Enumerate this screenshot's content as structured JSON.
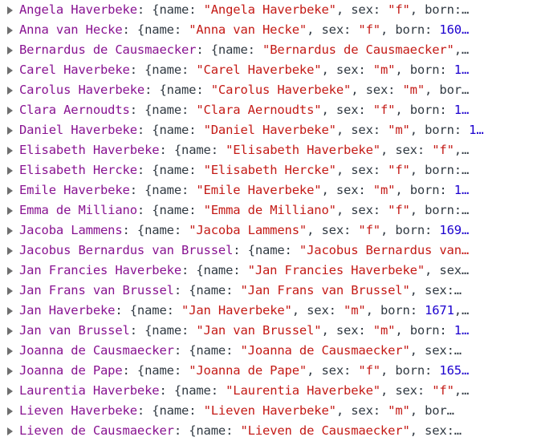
{
  "colors": {
    "key": "#881391",
    "string": "#c41a16",
    "number": "#1c00cf",
    "text": "#303942"
  },
  "icons": {
    "expand": "triangle-right-icon"
  },
  "rows": [
    {
      "key": "Angela Haverbeke",
      "name": "Angela Haverbeke",
      "sex": "f",
      "born": "",
      "tail": "born:…",
      "variant": "born-cut"
    },
    {
      "key": "Anna van Hecke",
      "name": "Anna van Hecke",
      "sex": "f",
      "born": "160…",
      "variant": "born-num"
    },
    {
      "key": "Bernardus de Causmaecker",
      "name": "Bernardus de Causmaecker",
      "variant": "name-only",
      "after": ",…"
    },
    {
      "key": "Carel Haverbeke",
      "name": "Carel Haverbeke",
      "sex": "m",
      "born": "1…",
      "variant": "born-num"
    },
    {
      "key": "Carolus Haverbeke",
      "name": "Carolus Haverbeke",
      "sex": "m",
      "tail": "bor…",
      "variant": "sex-tail"
    },
    {
      "key": "Clara Aernoudts",
      "name": "Clara Aernoudts",
      "sex": "f",
      "born": "1…",
      "variant": "born-num"
    },
    {
      "key": "Daniel Haverbeke",
      "name": "Daniel Haverbeke",
      "sex": "m",
      "born": "1…",
      "variant": "born-num"
    },
    {
      "key": "Elisabeth Haverbeke",
      "name": "Elisabeth Haverbeke",
      "sex": "f",
      "variant": "sex-end",
      "after": ",…"
    },
    {
      "key": "Elisabeth Hercke",
      "name": "Elisabeth Hercke",
      "sex": "f",
      "tail": "born:…",
      "variant": "sex-tail"
    },
    {
      "key": "Emile Haverbeke",
      "name": "Emile Haverbeke",
      "sex": "m",
      "born": "1…",
      "variant": "born-num"
    },
    {
      "key": "Emma de Milliano",
      "name": "Emma de Milliano",
      "sex": "f",
      "tail": "born:…",
      "variant": "sex-tail"
    },
    {
      "key": "Jacoba Lammens",
      "name": "Jacoba Lammens",
      "sex": "f",
      "born": "169…",
      "variant": "born-num"
    },
    {
      "key": "Jacobus Bernardus van Brussel",
      "name": "Jacobus Bernardus van…",
      "variant": "name-cut"
    },
    {
      "key": "Jan Francies Haverbeke",
      "name": "Jan Francies Haverbeke",
      "tail": "sex…",
      "variant": "name-tail"
    },
    {
      "key": "Jan Frans van Brussel",
      "name": "Jan Frans van Brussel",
      "tail": "sex:…",
      "variant": "name-tail"
    },
    {
      "key": "Jan Haverbeke",
      "name": "Jan Haverbeke",
      "sex": "m",
      "born": "1671",
      "variant": "born-num-comma"
    },
    {
      "key": "Jan van Brussel",
      "name": "Jan van Brussel",
      "sex": "m",
      "born": "1…",
      "variant": "born-num"
    },
    {
      "key": "Joanna de Causmaecker",
      "name": "Joanna de Causmaecker",
      "tail": "sex:…",
      "variant": "name-tail"
    },
    {
      "key": "Joanna de Pape",
      "name": "Joanna de Pape",
      "sex": "f",
      "born": "165…",
      "variant": "born-num"
    },
    {
      "key": "Laurentia Haverbeke",
      "name": "Laurentia Haverbeke",
      "sex": "f",
      "variant": "sex-end",
      "after": ",…"
    },
    {
      "key": "Lieven Haverbeke",
      "name": "Lieven Haverbeke",
      "sex": "m",
      "tail": "bor…",
      "variant": "sex-tail"
    },
    {
      "key": "Lieven de Causmaecker",
      "name": "Lieven de Causmaecker",
      "tail": "sex:…",
      "variant": "name-tail"
    }
  ]
}
